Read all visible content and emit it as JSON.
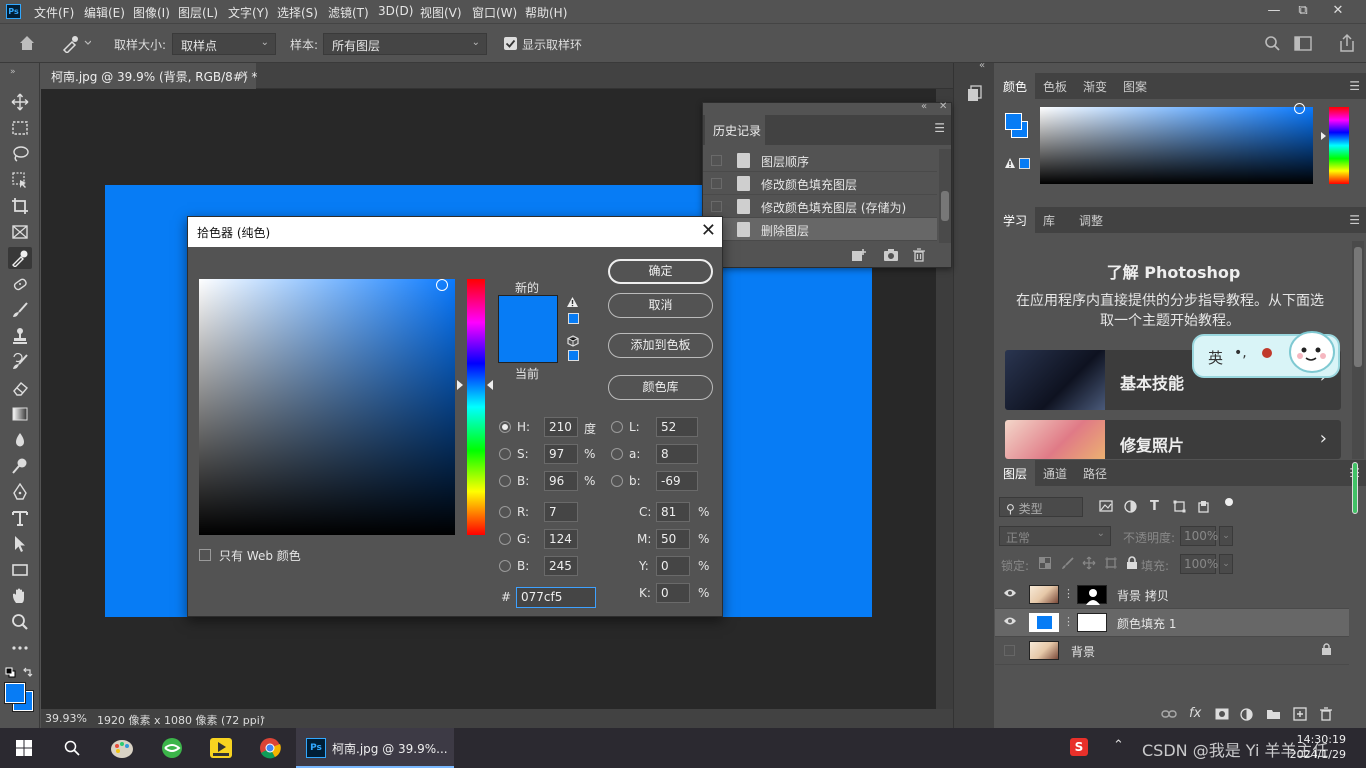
{
  "menubar": {
    "items": [
      "文件(F)",
      "编辑(E)",
      "图像(I)",
      "图层(L)",
      "文字(Y)",
      "选择(S)",
      "滤镜(T)",
      "3D(D)",
      "视图(V)",
      "窗口(W)",
      "帮助(H)"
    ],
    "logo": "Ps"
  },
  "options": {
    "sample_size_label": "取样大小:",
    "sample_size_value": "取样点",
    "sample_label": "样本:",
    "sample_value": "所有图层",
    "show_ring_label": "显示取样环"
  },
  "document": {
    "tab_title": "柯南.jpg @ 39.9% (背景, RGB/8#) *",
    "image_color": "#077cf5"
  },
  "status": {
    "zoom": "39.93%",
    "info": "1920 像素 x 1080 像素 (72 ppi)"
  },
  "history": {
    "tab_label": "历史记录",
    "items": [
      "图层顺序",
      "修改颜色填充图层",
      "修改颜色填充图层 (存储为)",
      "删除图层"
    ],
    "selected_index": 3
  },
  "picker": {
    "title": "拾色器 (纯色)",
    "new_label": "新的",
    "current_label": "当前",
    "buttons": {
      "ok": "确定",
      "cancel": "取消",
      "add_swatch": "添加到色板",
      "color_libraries": "颜色库"
    },
    "web_only_label": "只有 Web 颜色",
    "fields": {
      "H": "210",
      "S": "97",
      "B": "96",
      "R": "7",
      "G": "124",
      "B2": "245",
      "L": "52",
      "a": "8",
      "b": "-69",
      "C": "81",
      "M": "50",
      "Y": "0",
      "K": "0"
    },
    "labels": {
      "H": "H:",
      "S": "S:",
      "B": "B:",
      "R": "R:",
      "G": "G:",
      "B2": "B:",
      "L": "L:",
      "a": "a:",
      "b": "b:",
      "C": "C:",
      "M": "M:",
      "Y": "Y:",
      "K": "K:",
      "deg": "度",
      "pct": "%",
      "hash": "#"
    },
    "hex": "077cf5",
    "new_color": "#077cf5",
    "current_color": "#077cf5"
  },
  "color_panel": {
    "tabs": [
      "颜色",
      "色板",
      "渐变",
      "图案"
    ]
  },
  "learn_panel": {
    "tabs": [
      "学习",
      "库",
      "调整"
    ],
    "heading": "了解 Photoshop",
    "description": "在应用程序内直接提供的分步指导教程。从下面选取一个主题开始教程。",
    "cards": [
      "基本技能",
      "修复照片"
    ],
    "ime_text": "英"
  },
  "layers_panel": {
    "tabs": [
      "图层",
      "通道",
      "路径"
    ],
    "search_placeholder": "类型",
    "blend_mode": "正常",
    "opacity_label": "不透明度:",
    "opacity_value": "100%",
    "lock_label": "锁定:",
    "fill_label": "填充:",
    "fill_value": "100%",
    "layers": [
      {
        "name": "背景 拷贝"
      },
      {
        "name": "颜色填充 1"
      },
      {
        "name": "背景"
      }
    ],
    "selected_index": 1
  },
  "taskbar": {
    "ps_window_label": "柯南.jpg @ 39.9%...",
    "time": "14:30:19",
    "date": "2024/1/29",
    "watermark": "CSDN @我是 Yi 羊羊主任"
  }
}
